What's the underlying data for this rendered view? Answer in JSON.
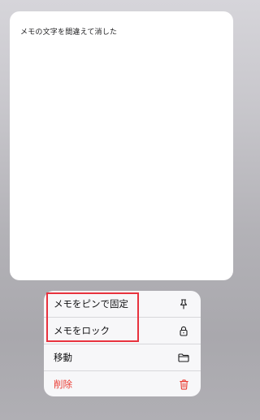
{
  "note": {
    "text": "メモの文字を間違えて消した"
  },
  "context_menu": {
    "items": [
      {
        "label": "メモをピンで固定",
        "icon": "pin-icon"
      },
      {
        "label": "メモをロック",
        "icon": "lock-icon"
      },
      {
        "label": "移動",
        "icon": "folder-icon"
      },
      {
        "label": "削除",
        "icon": "trash-icon",
        "destructive": true
      }
    ]
  },
  "colors": {
    "destructive": "#ea3a31",
    "highlight": "#e8323e",
    "menu_background": "#f7f7f9"
  }
}
